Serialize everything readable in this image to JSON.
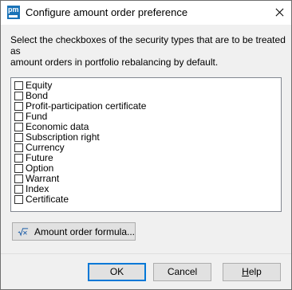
{
  "window": {
    "app_icon_text": "pm",
    "title": "Configure amount order preference"
  },
  "instruction": "Select the checkboxes of the security types that are to be treated as\namount orders in portfolio rebalancing by default.",
  "security_types": [
    {
      "label": "Equity",
      "checked": false
    },
    {
      "label": "Bond",
      "checked": false
    },
    {
      "label": "Profit-participation certificate",
      "checked": false
    },
    {
      "label": "Fund",
      "checked": false
    },
    {
      "label": "Economic data",
      "checked": false
    },
    {
      "label": "Subscription right",
      "checked": false
    },
    {
      "label": "Currency",
      "checked": false
    },
    {
      "label": "Future",
      "checked": false
    },
    {
      "label": "Option",
      "checked": false
    },
    {
      "label": "Warrant",
      "checked": false
    },
    {
      "label": "Index",
      "checked": false
    },
    {
      "label": "Certificate",
      "checked": false
    }
  ],
  "formula_button": {
    "label": "Amount order formula...",
    "icon": "formula-icon"
  },
  "footer": {
    "ok_label": "OK",
    "cancel_label": "Cancel",
    "help_first": "H",
    "help_rest": "elp"
  }
}
